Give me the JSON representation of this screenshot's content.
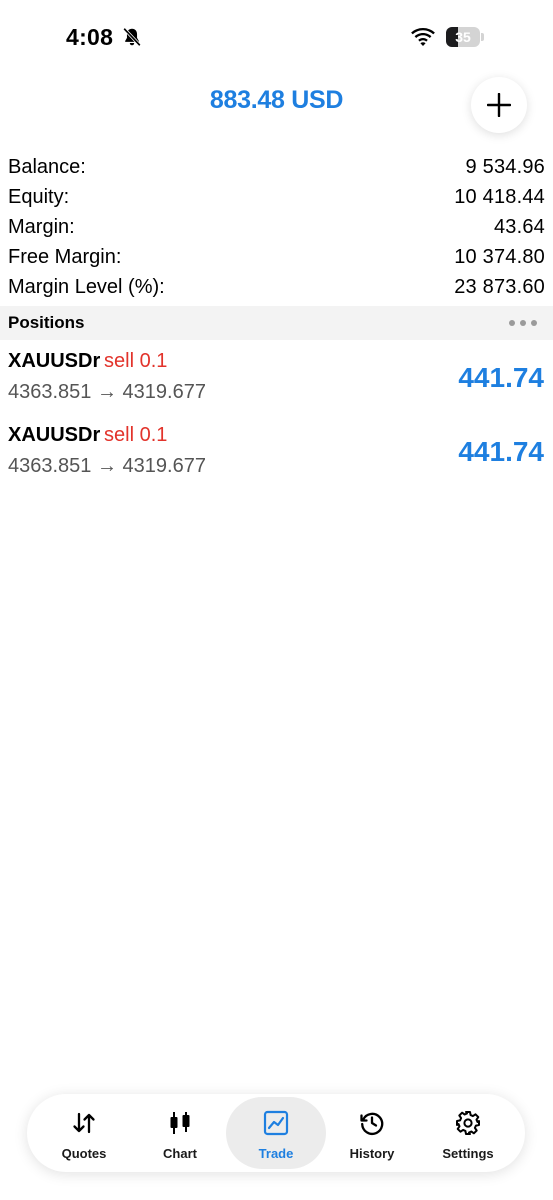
{
  "status_bar": {
    "time": "4:08",
    "battery": "35",
    "battery_level": 0.35
  },
  "header": {
    "balance_title": "883.48 USD",
    "add_icon": "plus-icon"
  },
  "summary": [
    {
      "label": "Balance:",
      "value": "9 534.96"
    },
    {
      "label": "Equity:",
      "value": "10 418.44"
    },
    {
      "label": "Margin:",
      "value": "43.64"
    },
    {
      "label": "Free Margin:",
      "value": "10 374.80"
    },
    {
      "label": "Margin Level (%):",
      "value": "23 873.60"
    }
  ],
  "positions_section": {
    "title": "Positions",
    "menu_icon": "more-icon"
  },
  "positions": [
    {
      "symbol": "XAUUSDr",
      "side": "sell 0.1",
      "prices": "4363.851 → 4319.677",
      "profit": "441.74"
    },
    {
      "symbol": "XAUUSDr",
      "side": "sell 0.1",
      "prices": "4363.851 → 4319.677",
      "profit": "441.74"
    }
  ],
  "tabs": [
    {
      "label": "Quotes",
      "icon": "quotes-arrows-icon",
      "active": false
    },
    {
      "label": "Chart",
      "icon": "candlestick-icon",
      "active": false
    },
    {
      "label": "Trade",
      "icon": "trade-chart-icon",
      "active": true
    },
    {
      "label": "History",
      "icon": "history-clock-icon",
      "active": false
    },
    {
      "label": "Settings",
      "icon": "gear-icon",
      "active": false
    }
  ],
  "colors": {
    "accent": "#1e7fe0",
    "sell": "#e2332b",
    "profit": "#1e7fe0"
  }
}
